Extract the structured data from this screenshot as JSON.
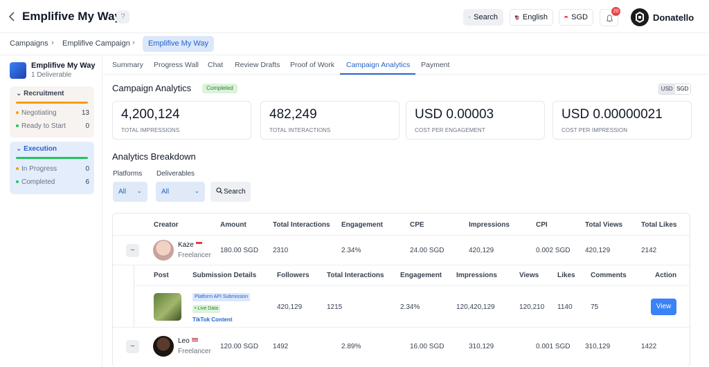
{
  "header": {
    "title": "Emplifive My Way",
    "help_icon": "question-icon",
    "search_label": "Search",
    "language_label": "English",
    "currency_label": "SGD",
    "notification_count": "20",
    "user_name": "Donatello"
  },
  "breadcrumb": {
    "items": [
      "Campaigns",
      "Emplifive Campaign",
      "Emplifive My Way"
    ]
  },
  "sidebar": {
    "campaign_name": "Emplifive My Way",
    "campaign_sub": "1 Deliverable",
    "recruitment": {
      "title": "Recruitment",
      "items": [
        {
          "label": "Negotiating",
          "count": "13"
        },
        {
          "label": "Ready to Start",
          "count": "0"
        }
      ]
    },
    "execution": {
      "title": "Execution",
      "items": [
        {
          "label": "In Progress",
          "count": "0"
        },
        {
          "label": "Completed",
          "count": "6"
        }
      ]
    }
  },
  "tabs": [
    "Summary",
    "Progress Wall",
    "Chat",
    "Review Drafts",
    "Proof of Work",
    "Campaign Analytics",
    "Payment"
  ],
  "analytics": {
    "title": "Campaign Analytics",
    "status": "Completed",
    "currency_toggle": [
      "USD",
      "SGD"
    ],
    "cards": [
      {
        "value": "4,200,124",
        "label": "TOTAL IMPRESSIONS"
      },
      {
        "value": "482,249",
        "label": "TOTAL INTERACTIONS"
      },
      {
        "value": "USD 0.00003",
        "label": "COST PER ENGAGEMENT"
      },
      {
        "value": "USD 0.00000021",
        "label": "COST PER IMPRESSION"
      }
    ]
  },
  "breakdown": {
    "title": "Analytics Breakdown",
    "platforms_label": "Platforms",
    "platforms_value": "All",
    "deliverables_label": "Deliverables",
    "deliverables_value": "All",
    "search_label": "Search"
  },
  "table": {
    "headers": [
      "Creator",
      "Amount",
      "Total Interactions",
      "Engagement",
      "CPE",
      "Impressions",
      "CPI",
      "Total Views",
      "Total Likes"
    ],
    "rows": [
      {
        "name": "Kaze",
        "role": "Freelancer",
        "amount": "180.00 SGD",
        "interactions": "2310",
        "engagement": "2.34%",
        "cpe": "24.00 SGD",
        "impressions": "420,129",
        "cpi": "0.002 SGD",
        "views": "420,129",
        "likes": "2142"
      },
      {
        "name": "Leo",
        "role": "Freelancer",
        "amount": "120.00 SGD",
        "interactions": "1492",
        "engagement": "2.89%",
        "cpe": "16.00 SGD",
        "impressions": "310,129",
        "cpi": "0.001 SGD",
        "views": "310,129",
        "likes": "1422"
      }
    ],
    "sub_headers": [
      "Post",
      "Submission Details",
      "Followers",
      "Total Interactions",
      "Engagement",
      "Impressions",
      "Views",
      "Likes",
      "Comments",
      "Action"
    ],
    "sub_row": {
      "tag_api": "Platform API Submission",
      "tag_live": "Live Data",
      "content_type": "TikTok Content",
      "followers": "420,129",
      "interactions": "1215",
      "engagement": "2.34%",
      "impressions": "120,420,129",
      "views": "120,210",
      "likes": "1140",
      "comments": "75",
      "action": "View"
    }
  }
}
